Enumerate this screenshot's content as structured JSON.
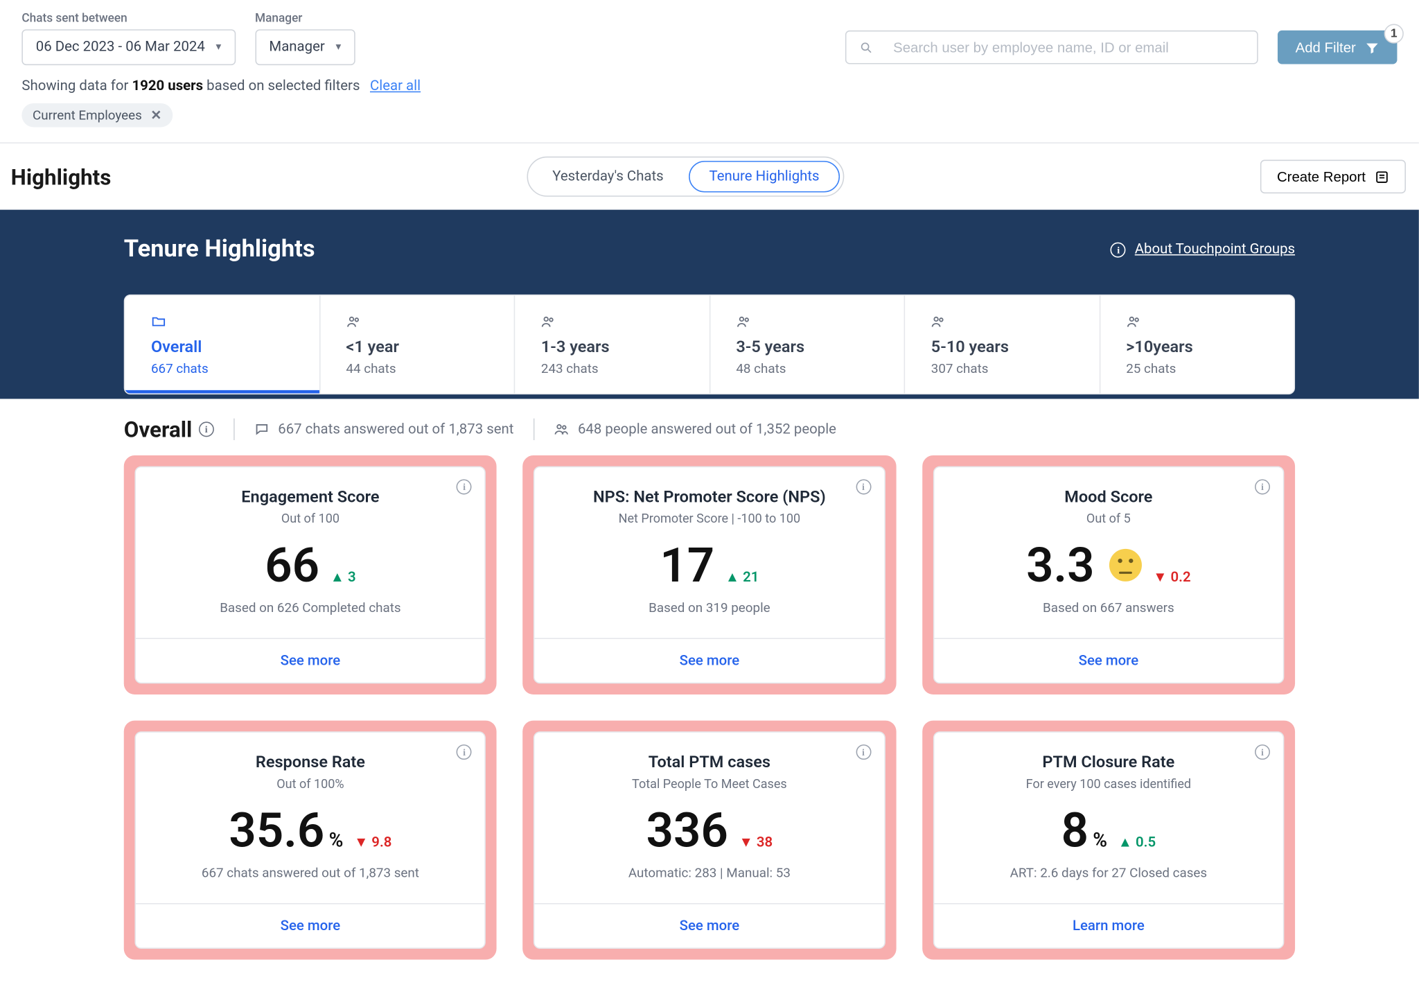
{
  "filters": {
    "date_label": "Chats sent between",
    "date_value": "06 Dec 2023 - 06 Mar 2024",
    "manager_label": "Manager",
    "manager_value": "Manager",
    "search_placeholder": "Search user by employee name, ID or email",
    "add_filter_label": "Add Filter",
    "add_filter_badge": "1",
    "meta_prefix": "Showing data for ",
    "meta_count": "1920 users",
    "meta_suffix": " based on selected filters",
    "clear_all": "Clear all",
    "chip_label": "Current Employees"
  },
  "header": {
    "title": "Highlights",
    "pill_yesterday": "Yesterday's Chats",
    "pill_tenure": "Tenure Highlights",
    "create_report": "Create Report"
  },
  "band": {
    "title": "Tenure Highlights",
    "about": "About Touchpoint Groups"
  },
  "tenure_tabs": [
    {
      "label": "Overall",
      "sub": "667 chats",
      "active": true,
      "icon": "folder"
    },
    {
      "label": "<1 year",
      "sub": "44 chats",
      "active": false,
      "icon": "people"
    },
    {
      "label": "1-3 years",
      "sub": "243 chats",
      "active": false,
      "icon": "people"
    },
    {
      "label": "3-5 years",
      "sub": "48 chats",
      "active": false,
      "icon": "people"
    },
    {
      "label": "5-10 years",
      "sub": "307 chats",
      "active": false,
      "icon": "people"
    },
    {
      "label": ">10years",
      "sub": "25 chats",
      "active": false,
      "icon": "people"
    }
  ],
  "overall_head": {
    "title": "Overall",
    "chats_stat": "667 chats answered out of 1,873 sent",
    "people_stat": "648 people answered out of 1,352 people"
  },
  "cards": [
    {
      "title": "Engagement Score",
      "sub": "Out of 100",
      "value": "66",
      "unit": "",
      "delta_dir": "up",
      "delta_val": "3",
      "basis": "Based on 626 Completed chats",
      "link": "See more",
      "mood": false
    },
    {
      "title": "NPS: Net Promoter Score (NPS)",
      "sub": "Net Promoter Score | -100 to 100",
      "value": "17",
      "unit": "",
      "delta_dir": "up",
      "delta_val": "21",
      "basis": "Based on 319 people",
      "link": "See more",
      "mood": false
    },
    {
      "title": "Mood Score",
      "sub": "Out of 5",
      "value": "3.3",
      "unit": "",
      "delta_dir": "down",
      "delta_val": "0.2",
      "basis": "Based on 667 answers",
      "link": "See more",
      "mood": true
    },
    {
      "title": "Response Rate",
      "sub": "Out of 100%",
      "value": "35.6",
      "unit": "%",
      "delta_dir": "down",
      "delta_val": "9.8",
      "basis": "667 chats answered out of 1,873 sent",
      "link": "See more",
      "mood": false
    },
    {
      "title": "Total PTM cases",
      "sub": "Total People To Meet Cases",
      "value": "336",
      "unit": "",
      "delta_dir": "down",
      "delta_val": "38",
      "basis": "Automatic: 283 | Manual: 53",
      "link": "See more",
      "mood": false
    },
    {
      "title": "PTM Closure Rate",
      "sub": "For every 100 cases identified",
      "value": "8",
      "unit": "%",
      "delta_dir": "up",
      "delta_val": "0.5",
      "basis": "ART: 2.6 days for 27 Closed cases",
      "link": "Learn more",
      "mood": false
    }
  ]
}
